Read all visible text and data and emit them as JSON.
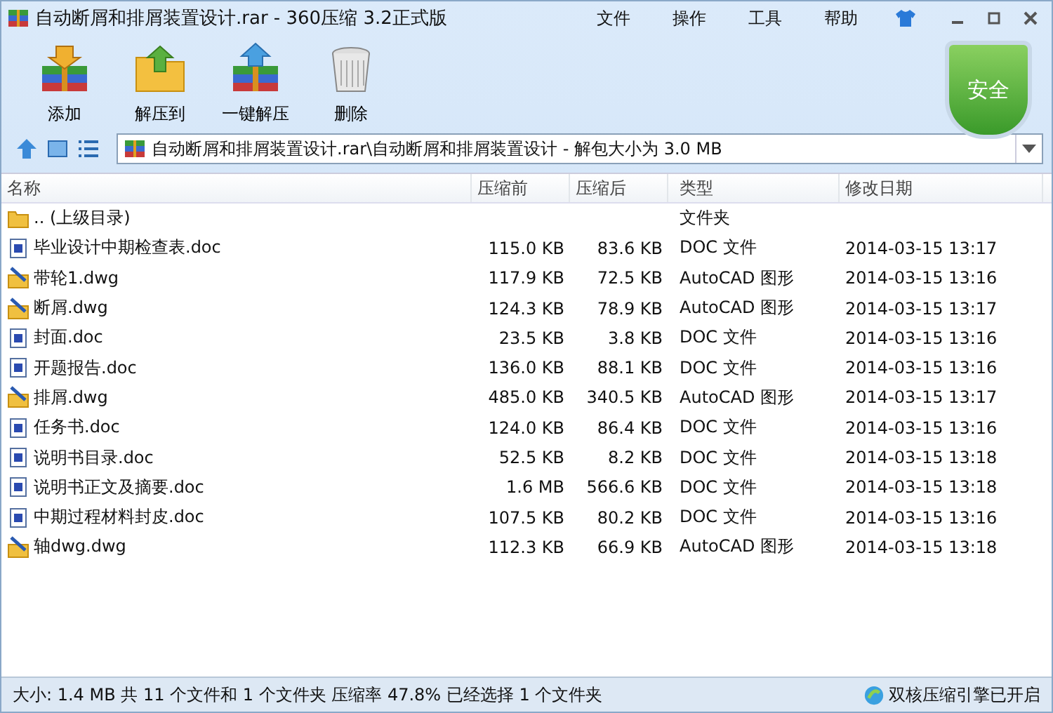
{
  "window": {
    "title": "自动断屑和排屑装置设计.rar - 360压缩 3.2正式版"
  },
  "menu": [
    "文件",
    "操作",
    "工具",
    "帮助"
  ],
  "toolbar": [
    {
      "label": "添加",
      "kind": "add"
    },
    {
      "label": "解压到",
      "kind": "extract"
    },
    {
      "label": "一键解压",
      "kind": "quick"
    },
    {
      "label": "删除",
      "kind": "delete"
    }
  ],
  "security_badge": "安全",
  "address": {
    "path": "自动断屑和排屑装置设计.rar\\自动断屑和排屑装置设计 - 解包大小为 3.0 MB"
  },
  "table": {
    "columns": [
      "名称",
      "压缩前",
      "压缩后",
      "类型",
      "修改日期"
    ],
    "rows": [
      {
        "kind": "folder",
        "name": ".. (上级目录)",
        "size": "",
        "packed": "",
        "type": "文件夹",
        "date": ""
      },
      {
        "kind": "doc",
        "name": "毕业设计中期检查表.doc",
        "size": "115.0 KB",
        "packed": "83.6 KB",
        "type": "DOC 文件",
        "date": "2014-03-15 13:17"
      },
      {
        "kind": "dwg",
        "name": "带轮1.dwg",
        "size": "117.9 KB",
        "packed": "72.5 KB",
        "type": "AutoCAD 图形",
        "date": "2014-03-15 13:16"
      },
      {
        "kind": "dwg",
        "name": "断屑.dwg",
        "size": "124.3 KB",
        "packed": "78.9 KB",
        "type": "AutoCAD 图形",
        "date": "2014-03-15 13:17"
      },
      {
        "kind": "doc",
        "name": "封面.doc",
        "size": "23.5 KB",
        "packed": "3.8 KB",
        "type": "DOC 文件",
        "date": "2014-03-15 13:16"
      },
      {
        "kind": "doc",
        "name": "开题报告.doc",
        "size": "136.0 KB",
        "packed": "88.1 KB",
        "type": "DOC 文件",
        "date": "2014-03-15 13:16"
      },
      {
        "kind": "dwg",
        "name": "排屑.dwg",
        "size": "485.0 KB",
        "packed": "340.5 KB",
        "type": "AutoCAD 图形",
        "date": "2014-03-15 13:17"
      },
      {
        "kind": "doc",
        "name": "任务书.doc",
        "size": "124.0 KB",
        "packed": "86.4 KB",
        "type": "DOC 文件",
        "date": "2014-03-15 13:16"
      },
      {
        "kind": "doc",
        "name": "说明书目录.doc",
        "size": "52.5 KB",
        "packed": "8.2 KB",
        "type": "DOC 文件",
        "date": "2014-03-15 13:18"
      },
      {
        "kind": "doc",
        "name": "说明书正文及摘要.doc",
        "size": "1.6 MB",
        "packed": "566.6 KB",
        "type": "DOC 文件",
        "date": "2014-03-15 13:18"
      },
      {
        "kind": "doc",
        "name": "中期过程材料封皮.doc",
        "size": "107.5 KB",
        "packed": "80.2 KB",
        "type": "DOC 文件",
        "date": "2014-03-15 13:16"
      },
      {
        "kind": "dwg",
        "name": "轴dwg.dwg",
        "size": "112.3 KB",
        "packed": "66.9 KB",
        "type": "AutoCAD 图形",
        "date": "2014-03-15 13:18"
      }
    ]
  },
  "status_bar": {
    "summary": "大小: 1.4 MB 共 11 个文件和 1 个文件夹 压缩率 47.8% 已经选择 1 个文件夹",
    "engine": "双核压缩引擎已开启"
  }
}
